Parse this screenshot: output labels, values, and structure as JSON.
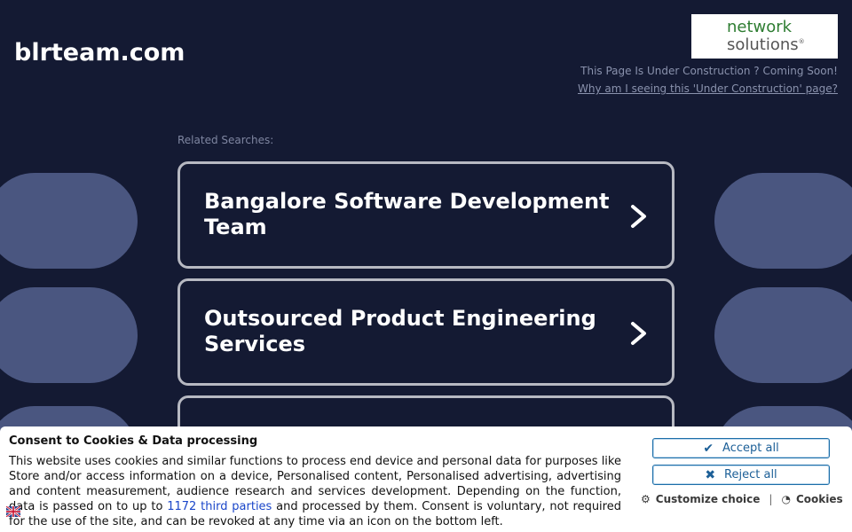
{
  "header": {
    "domain": "blrteam.com",
    "logo_line1": "network",
    "logo_line2": "solutions",
    "under_construction": "This Page Is Under Construction ? Coming Soon!",
    "why_link": "Why am I seeing this 'Under Construction' page?"
  },
  "related": {
    "label": "Related Searches:",
    "items": [
      {
        "text": "Bangalore Software Development Team"
      },
      {
        "text": "Outsourced Product Engineering Services"
      }
    ]
  },
  "consent": {
    "title": "Consent to Cookies & Data processing",
    "text_part1": "This website uses cookies and similar functions to process end device and personal data for purposes like Store and/or access information on a device, Personalised content, Personalised advertising, advertising and content measurement, audience research and services development. Depending on the function, data is passed on to up to",
    "third_parties_link": "1172 third parties",
    "text_part2": "and processed by them. Consent is voluntary, not required for the use of the site, and can be revoked at any time via an icon on the bottom left.",
    "accept_label": "Accept all",
    "reject_label": "Reject all",
    "customize_label": "Customize choice",
    "cookies_label": "Cookies",
    "separator": "|"
  },
  "colors": {
    "background": "#141a33",
    "pill": "#4a5680",
    "card_border": "#b7b9c2",
    "button_text": "#1c5f97"
  }
}
